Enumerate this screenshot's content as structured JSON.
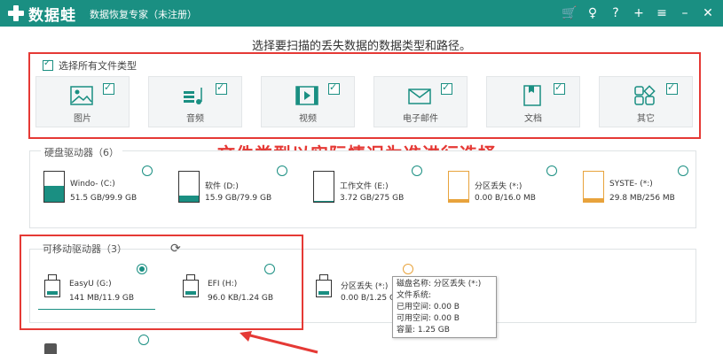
{
  "app": {
    "brand": "数据蛙",
    "subtitle": "数据恢复专家（未注册）",
    "toolbar_icons": [
      "cart-icon",
      "key-icon",
      "help-icon",
      "plus-icon",
      "menu-icon",
      "minimize-icon",
      "close-icon"
    ],
    "toolbar_glyphs": [
      "🛒",
      "♀",
      "?",
      "+",
      "≡",
      "–",
      "✕"
    ]
  },
  "prompt": "选择要扫描的丢失数据的数据类型和路径。",
  "select_all": {
    "label": "选择所有文件类型",
    "checked": true
  },
  "file_types": [
    {
      "label": "图片",
      "icon": "image-icon",
      "checked": true
    },
    {
      "label": "音频",
      "icon": "audio-icon",
      "checked": true
    },
    {
      "label": "视频",
      "icon": "video-icon",
      "checked": true
    },
    {
      "label": "电子邮件",
      "icon": "email-icon",
      "checked": true
    },
    {
      "label": "文档",
      "icon": "document-icon",
      "checked": true
    },
    {
      "label": "其它",
      "icon": "other-icon",
      "checked": true
    }
  ],
  "annotation": "文件类型以实际情况为准进行选择",
  "hard_drives": {
    "title": "硬盘驱动器（6）",
    "items": [
      {
        "name": "Windo- (C:)",
        "size": "51.5 GB/99.9 GB",
        "used": 0.52,
        "color": "#1a8f82"
      },
      {
        "name": "软件 (D:)",
        "size": "15.9 GB/79.9 GB",
        "used": 0.2,
        "color": "#1a8f82"
      },
      {
        "name": "工作文件 (E:)",
        "size": "3.72 GB/275 GB",
        "used": 0.02,
        "color": "#1a8f82"
      },
      {
        "name": "分区丢失 (*:)",
        "size": "0.00  B/16.0 MB",
        "used": 0.0,
        "color": "#e8a33c"
      },
      {
        "name": "SYSTE- (*:)",
        "size": "29.8 MB/256 MB",
        "used": 0.12,
        "color": "#e8a33c"
      }
    ]
  },
  "removable_drives": {
    "title": "可移动驱动器（3）",
    "items": [
      {
        "name": "EasyU (G:)",
        "size": "141 MB/11.9 GB",
        "selected": true
      },
      {
        "name": "EFI (H:)",
        "size": "96.0 KB/1.24 GB",
        "selected": false
      },
      {
        "name": "分区丢失 (*:)",
        "size": "0.00  B/1.25 GB",
        "selected": false
      }
    ]
  },
  "tooltip": {
    "lines": [
      "磁盘名称:  分区丢失 (*:)",
      "文件系统:",
      "已用空间:  0.00  B",
      "可用空间:  0.00  B",
      "容量:  1.25 GB"
    ]
  },
  "colors": {
    "accent": "#1a8f82",
    "annotation": "#e53935",
    "lost": "#e8a33c"
  }
}
